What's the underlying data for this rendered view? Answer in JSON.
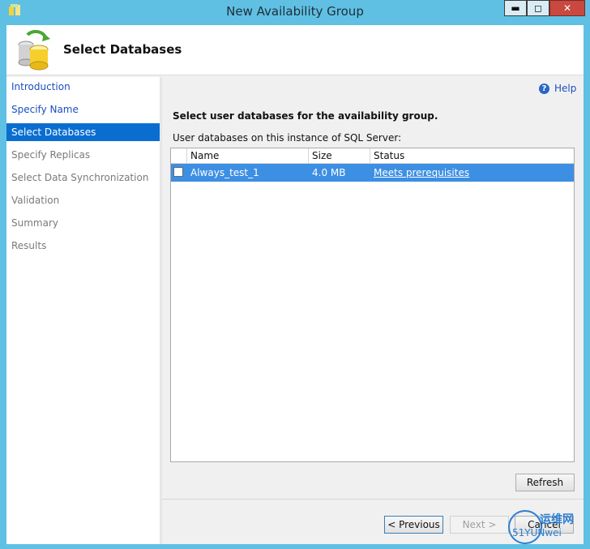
{
  "window": {
    "title": "New Availability Group",
    "controls": {
      "minimize": "▬",
      "maximize": "◻",
      "close": "✕"
    }
  },
  "header": {
    "title": "Select Databases"
  },
  "nav": {
    "items": [
      {
        "label": "Introduction",
        "state": "link"
      },
      {
        "label": "Specify Name",
        "state": "link"
      },
      {
        "label": "Select Databases",
        "state": "active"
      },
      {
        "label": "Specify Replicas",
        "state": "disabled"
      },
      {
        "label": "Select Data Synchronization",
        "state": "disabled"
      },
      {
        "label": "Validation",
        "state": "disabled"
      },
      {
        "label": "Summary",
        "state": "disabled"
      },
      {
        "label": "Results",
        "state": "disabled"
      }
    ]
  },
  "main": {
    "help_label": "Help",
    "help_icon": "question-icon",
    "instruction": "Select user databases for the availability group.",
    "sublabel": "User databases on this instance of SQL Server:",
    "table": {
      "columns": [
        "Name",
        "Size",
        "Status"
      ],
      "rows": [
        {
          "checked": false,
          "name": "Always_test_1",
          "size": "4.0 MB",
          "status": "Meets prerequisites"
        }
      ]
    },
    "refresh_label": "Refresh"
  },
  "footer": {
    "previous_label": "< Previous",
    "next_label": "Next >",
    "cancel_label": "Cancel"
  },
  "watermark": {
    "line1": "运维网",
    "line2": "51YUNwei"
  },
  "colors": {
    "titlebar": "#5fc0e3",
    "selection": "#0a6ed1",
    "row_highlight": "#3d8fe4",
    "link": "#1a4fbf"
  }
}
